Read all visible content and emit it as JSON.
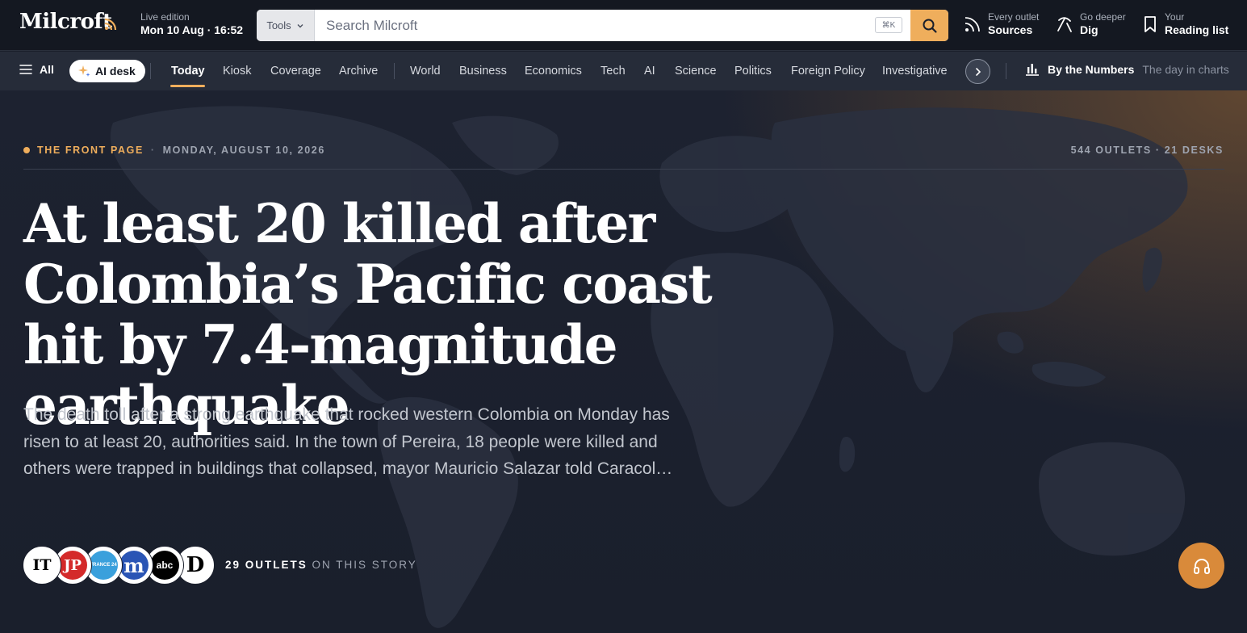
{
  "brand": {
    "name": "Milcroft",
    "accent": "#efae5c"
  },
  "edition": {
    "label": "Live edition",
    "value": "Mon 10 Aug · 16:52"
  },
  "search": {
    "tools_label": "Tools",
    "placeholder": "Search Milcroft",
    "shortcut": "⌘K"
  },
  "top_links": [
    {
      "kicker": "Every outlet",
      "label": "Sources",
      "icon": "rss-icon"
    },
    {
      "kicker": "Go deeper",
      "label": "Dig",
      "icon": "pickaxe-icon"
    },
    {
      "kicker": "Your",
      "label": "Reading list",
      "icon": "bookmark-icon"
    }
  ],
  "nav": {
    "all_label": "All",
    "ai_desk_label": "AI desk",
    "primary": [
      "Today",
      "Kiosk",
      "Coverage",
      "Archive"
    ],
    "active": "Today",
    "sections": [
      "World",
      "Business",
      "Economics",
      "Tech",
      "AI",
      "Science",
      "Politics",
      "Foreign Policy",
      "Investigative"
    ],
    "numbers_label": "By the Numbers",
    "numbers_sub": "The day in charts"
  },
  "hero": {
    "section": "THE FRONT PAGE",
    "separator": "·",
    "date": "MONDAY, AUGUST 10, 2026",
    "counts": "544 OUTLETS · 21 DESKS",
    "headline": "At least 20 killed after Colombia’s Pacific coast hit by 7.4-magnitude earthquake",
    "dek": "The death toll after a strong earthquake that rocked western Colombia on Monday has risen to at least 20, authorities said. In the town of Pereira, 18 people were killed and others were trapped in buildings that collapsed, mayor Mauricio Salazar told Caracol…",
    "outlet_logos": [
      {
        "text": "IT",
        "bg": "#ffffff",
        "fg": "#000000"
      },
      {
        "text": "JP",
        "bg": "#d42a2a",
        "fg": "#ffffff"
      },
      {
        "text": "FRANCE 24",
        "bg": "#3aa0dc",
        "fg": "#ffffff"
      },
      {
        "text": "m",
        "bg": "#2a55b5",
        "fg": "#ffffff"
      },
      {
        "text": "abc",
        "bg": "#000000",
        "fg": "#ffffff"
      },
      {
        "text": "D",
        "bg": "#ffffff",
        "fg": "#000000"
      }
    ],
    "outlet_count": "29 OUTLETS",
    "outlet_suffix": "ON THIS STORY"
  }
}
